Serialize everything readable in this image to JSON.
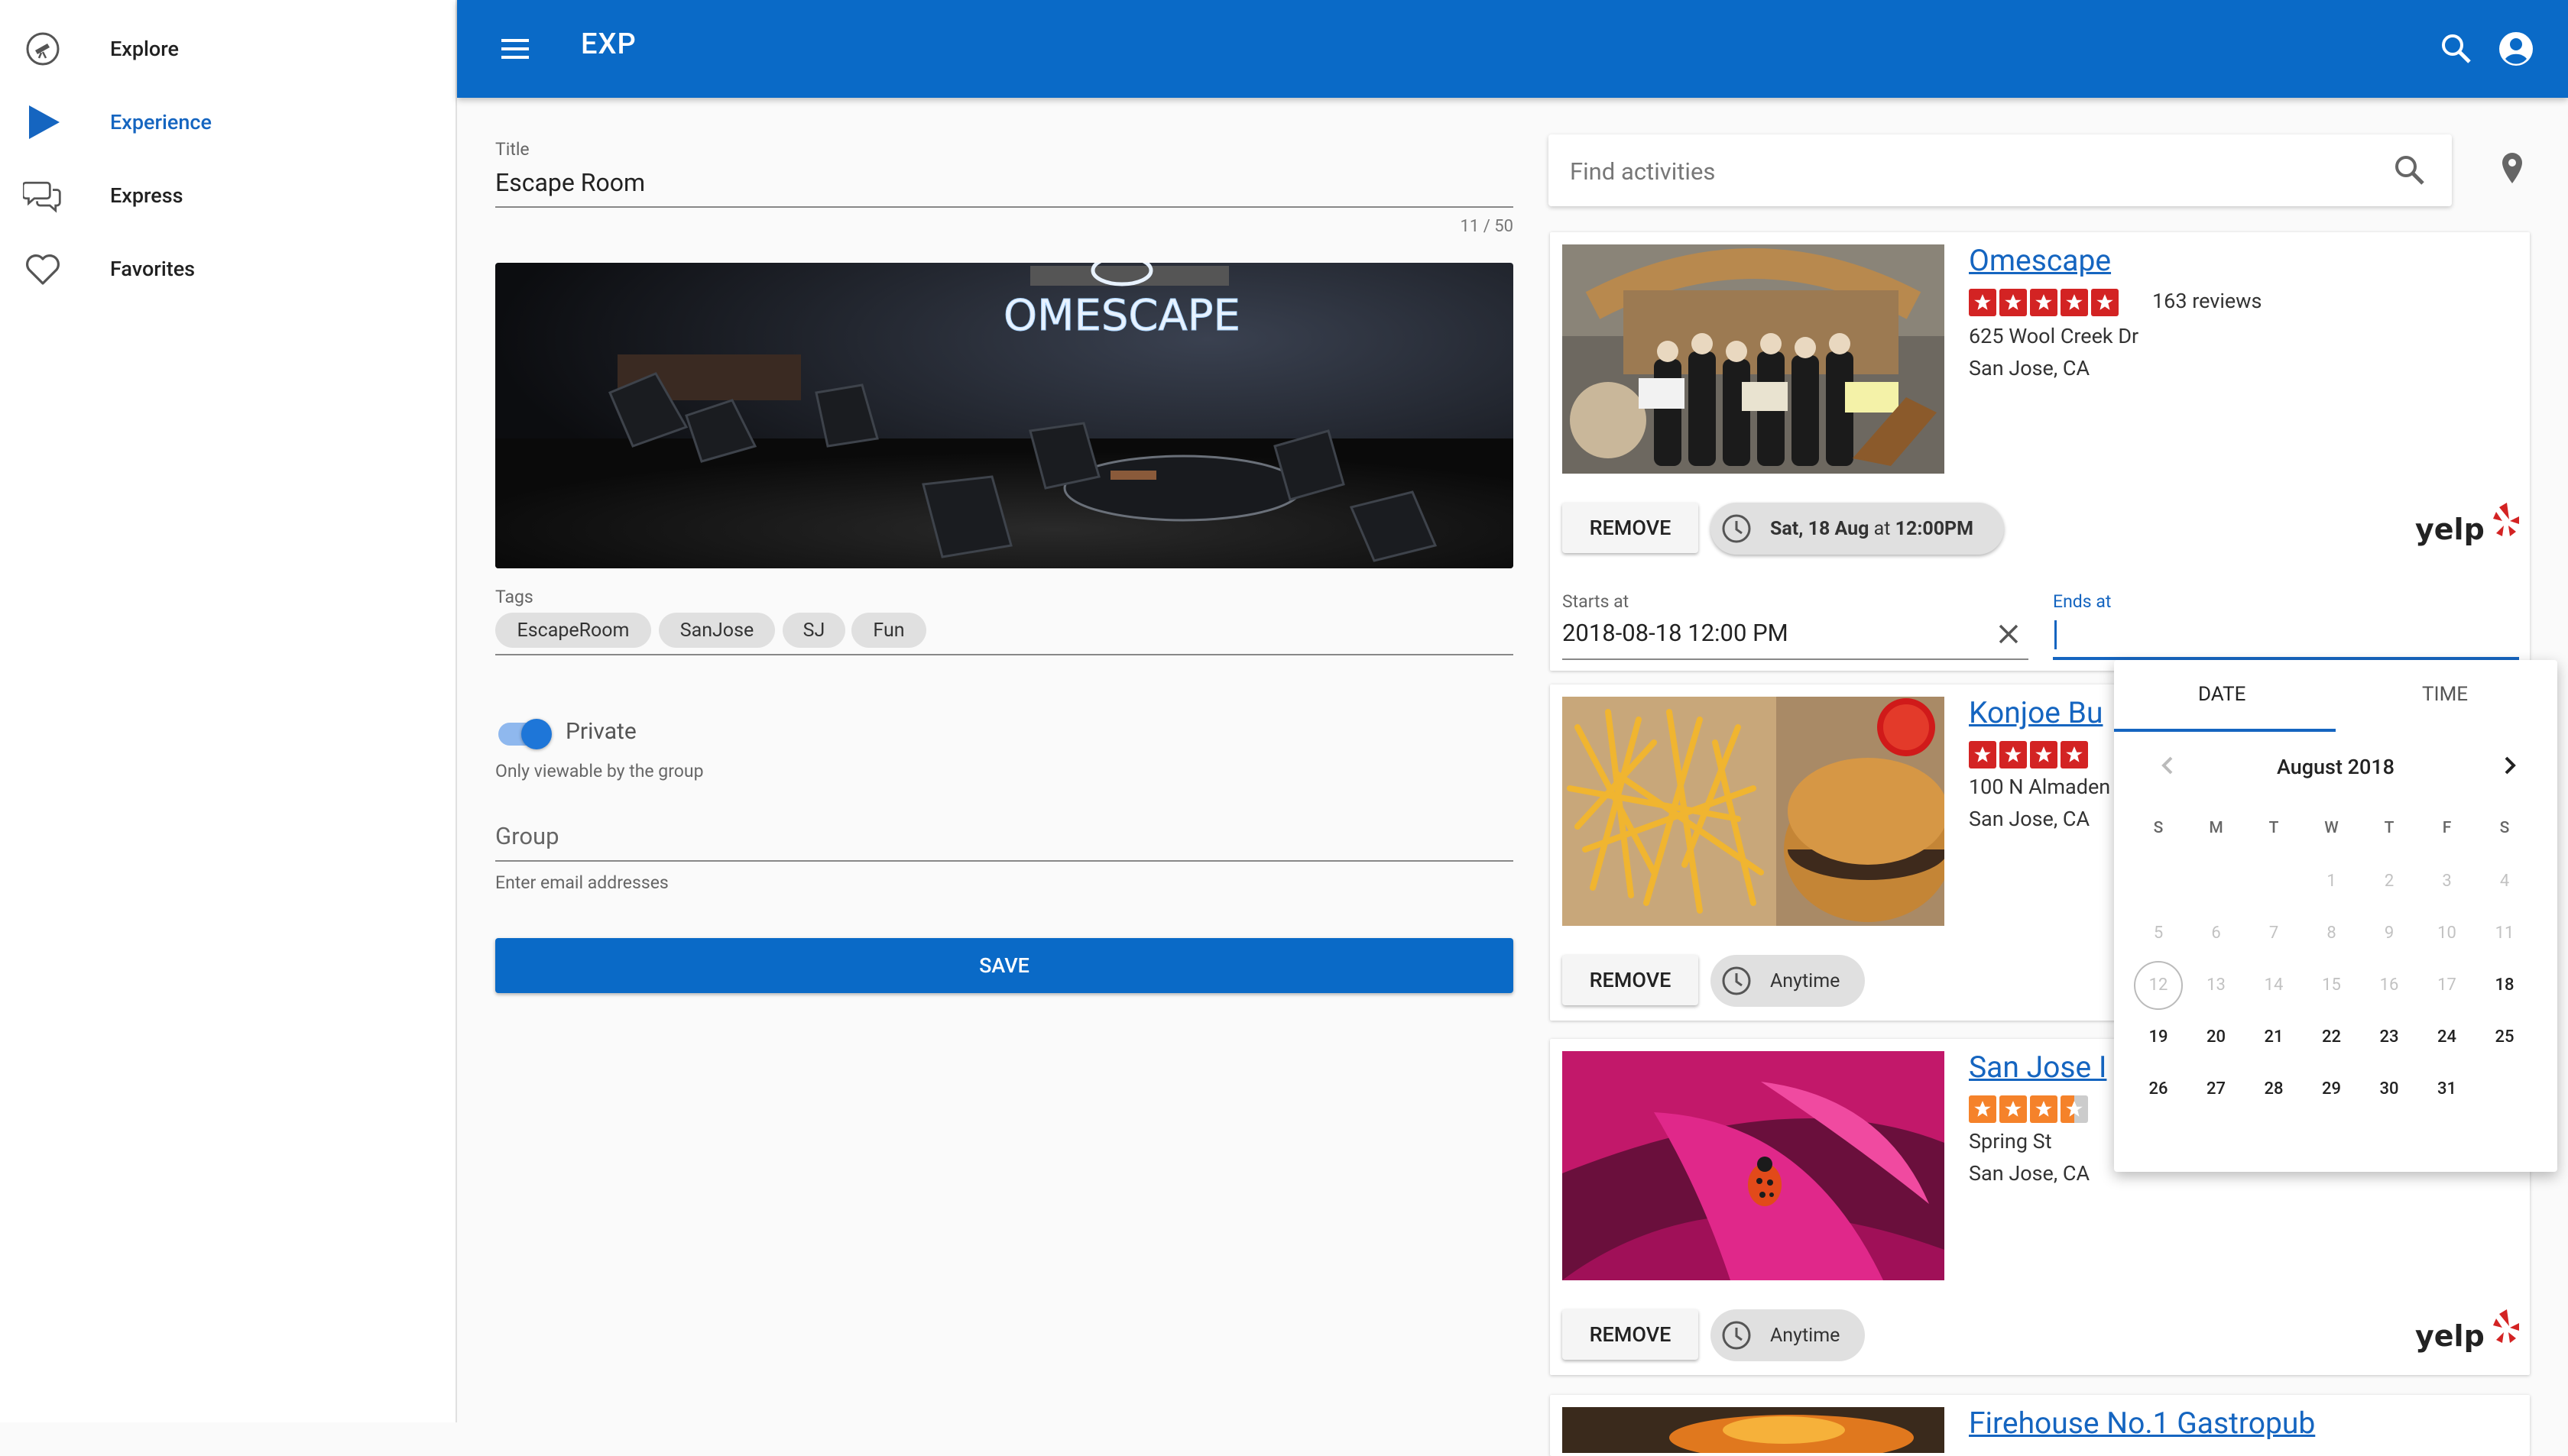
{
  "sidebar": {
    "items": [
      {
        "label": "Explore",
        "icon": "telescope-icon"
      },
      {
        "label": "Experience",
        "icon": "play-icon",
        "active": true
      },
      {
        "label": "Express",
        "icon": "chat-icon"
      },
      {
        "label": "Favorites",
        "icon": "heart-icon"
      }
    ]
  },
  "topbar": {
    "title": "EXP",
    "menu_icon": "menu-icon",
    "search_icon": "search-icon",
    "account_icon": "account-icon"
  },
  "form": {
    "title_label": "Title",
    "title_value": "Escape Room",
    "title_counter": "11 / 50",
    "hero_sign": "OMESCAPE",
    "tags_label": "Tags",
    "tags": [
      "EscapeRoom",
      "SanJose",
      "SJ",
      "Fun"
    ],
    "private_label": "Private",
    "private_on": true,
    "private_helper": "Only viewable by the group",
    "group_placeholder": "Group",
    "group_helper": "Enter email addresses",
    "save_label": "SAVE"
  },
  "search": {
    "placeholder": "Find activities"
  },
  "cards": [
    {
      "name": "Omescape",
      "rating": 5,
      "reviews": "163 reviews",
      "address1": "625 Wool Creek Dr",
      "address2": "San Jose, CA",
      "remove_label": "REMOVE",
      "time_day": "Sat, 18 Aug",
      "time_at": "at",
      "time_hour": "12:00PM",
      "starts_label": "Starts at",
      "starts_value": "2018-08-18 12:00 PM",
      "ends_label": "Ends at",
      "yelp": "yelp"
    },
    {
      "name": "Konjoe Bu",
      "rating": 4,
      "address1": "100 N Almaden",
      "address2": "San Jose, CA",
      "remove_label": "REMOVE",
      "time_label": "Anytime"
    },
    {
      "name": "San Jose I",
      "rating": 3.5,
      "address1": "Spring St",
      "address2": "San Jose, CA",
      "remove_label": "REMOVE",
      "time_label": "Anytime",
      "yelp": "yelp"
    },
    {
      "name": "Firehouse No.1 Gastropub"
    }
  ],
  "datepicker": {
    "tab_date": "DATE",
    "tab_time": "TIME",
    "month": "August 2018",
    "weekdays": [
      "S",
      "M",
      "T",
      "W",
      "T",
      "F",
      "S"
    ],
    "weeks": [
      [
        "",
        "",
        "",
        "1",
        "2",
        "3",
        "4"
      ],
      [
        "5",
        "6",
        "7",
        "8",
        "9",
        "10",
        "11"
      ],
      [
        "12",
        "13",
        "14",
        "15",
        "16",
        "17",
        "18"
      ],
      [
        "19",
        "20",
        "21",
        "22",
        "23",
        "24",
        "25"
      ],
      [
        "26",
        "27",
        "28",
        "29",
        "30",
        "31",
        ""
      ]
    ],
    "today": "12",
    "first_enabled": "18"
  },
  "colors": {
    "primary": "#0a6ac7",
    "link": "#1565c0",
    "yelp_red": "#d32323",
    "star_orange": "#f5822a",
    "star_empty": "#cccccc"
  }
}
